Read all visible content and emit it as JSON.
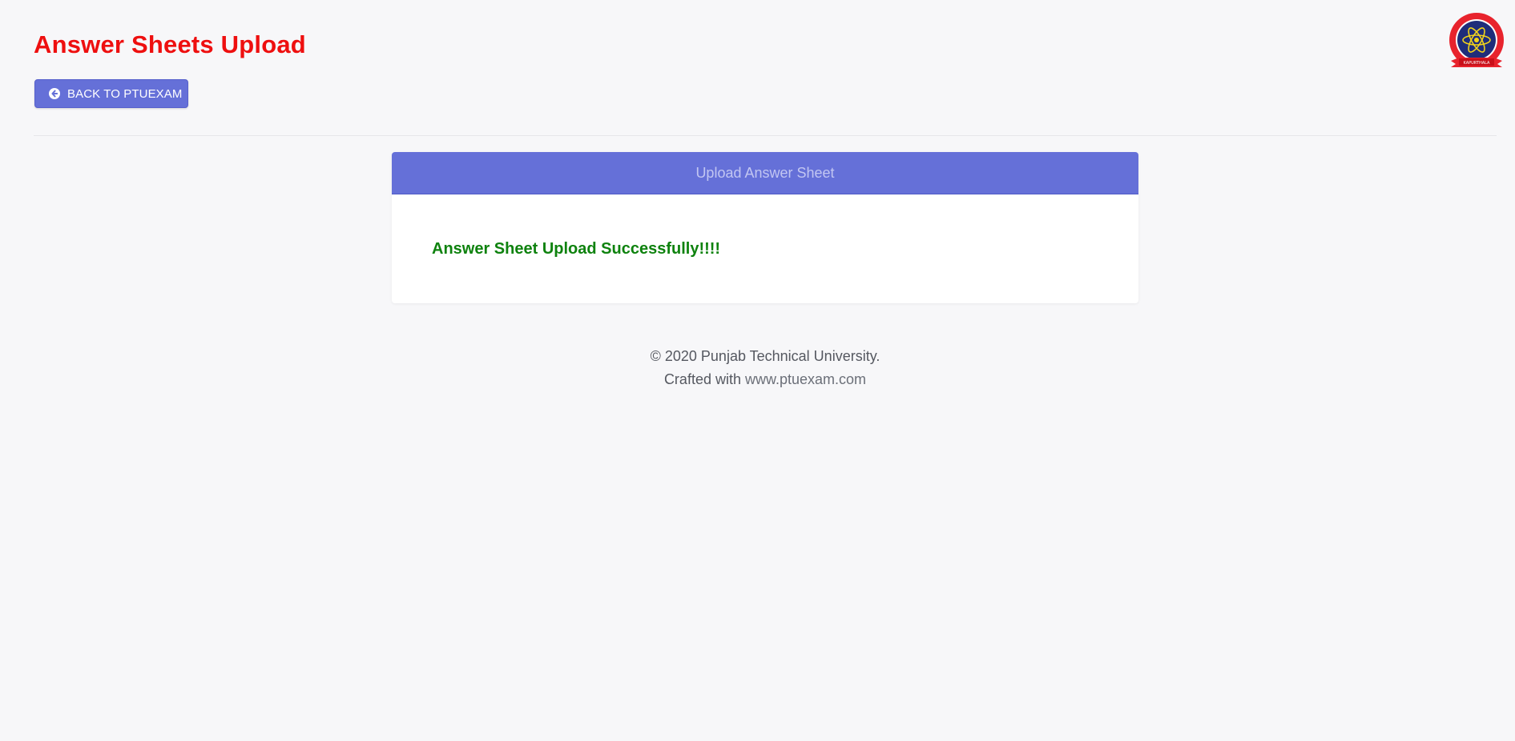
{
  "header": {
    "title": "Answer Sheets Upload",
    "back_button_label": "BACK TO PTUEXAM",
    "back_icon": "arrow-circle-left-icon",
    "logo_icon": "university-seal-logo",
    "logo_text": "KAPURTHALA"
  },
  "card": {
    "header_title": "Upload Answer Sheet",
    "message": "Answer Sheet Upload Successfully!!!!"
  },
  "footer": {
    "copyright": "© 2020 Punjab Technical University.",
    "crafted_prefix": "Crafted with",
    "link_text": "www.ptuexam.com"
  },
  "colors": {
    "title_red": "#ee0f0f",
    "accent": "#6570d8",
    "success_green": "#0e820e",
    "background": "#f7f7f9"
  }
}
